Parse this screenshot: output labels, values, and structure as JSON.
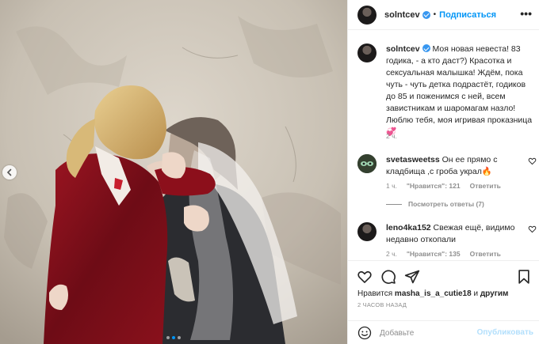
{
  "header": {
    "username": "solntcev",
    "separator": "•",
    "follow_label": "Подписаться",
    "more_label": "•••"
  },
  "caption": {
    "username": "solntcev",
    "text": "Моя новая невеста! 83 годика, - а кто даст?) Красотка и сексуальная малышка! Ждём, пока чуть - чуть детка подрастёт, годиков до 85 и поженимся с ней, всем завистникам и шаромагам назло! Люблю тебя, моя игривая проказница 💞",
    "time": "2 ч."
  },
  "comments": [
    {
      "username": "svetasweetss",
      "text": "Он ее прямо с кладбища ,с гроба украл🔥",
      "time": "1 ч.",
      "likes": "\"Нравится\": 121",
      "reply_label": "Ответить"
    },
    {
      "username": "leno4ka152",
      "text": "Свежая ещё, видимо недавно откопали",
      "time": "2 ч.",
      "likes": "\"Нравится\": 135",
      "reply_label": "Ответить"
    }
  ],
  "view_replies_label": "Посмотреть ответы (7)",
  "likes_bar": {
    "prefix": "Нравится",
    "user": "masha_is_a_cutie18",
    "suffix": "и",
    "others": "другим"
  },
  "timestamp": "2 ЧАСОВ НАЗАД",
  "composer": {
    "placeholder": "Добавьте",
    "publish_label": "Опубликовать"
  },
  "carousel": {
    "dot_count": 3,
    "active_index": 1
  },
  "colors": {
    "accent": "#0095f6",
    "verified": "#3897f0",
    "muted": "#8e8e8e",
    "publish_disabled": "#b2dffc"
  },
  "icons": [
    "chevron-left-icon",
    "more-icon",
    "verified-icon",
    "heart-icon",
    "comment-icon",
    "share-icon",
    "bookmark-icon",
    "emoji-icon"
  ]
}
